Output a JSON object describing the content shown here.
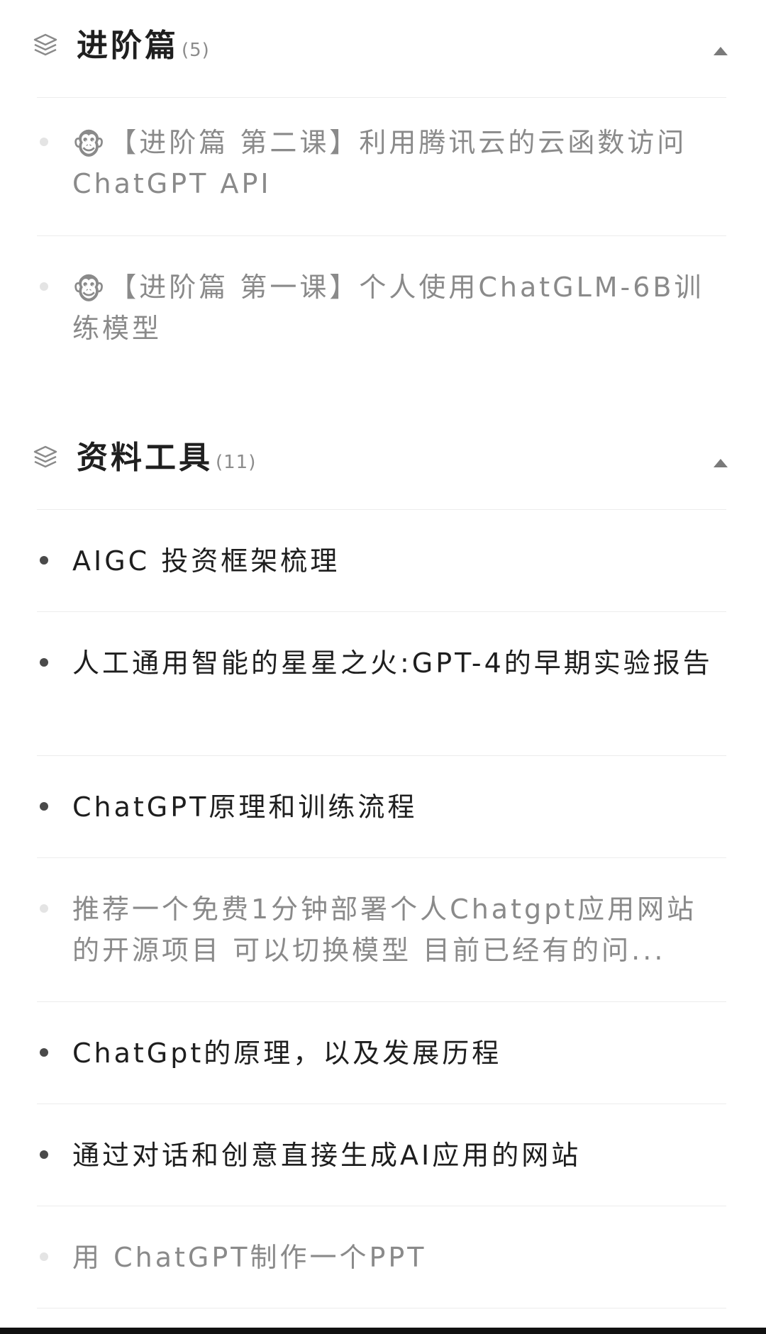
{
  "sections": [
    {
      "title": "进阶篇",
      "count": "(5)",
      "items": [
        {
          "emoji": "🐵",
          "label": "【进阶篇 第二课】利用腾讯云的云函数访问ChatGPT API"
        },
        {
          "emoji": "🐵",
          "label": "【进阶篇 第一课】个人使用ChatGLM-6B训练模型"
        }
      ]
    },
    {
      "title": "资料工具",
      "count": "(11)",
      "items": [
        {
          "label": "AIGC 投资框架梳理"
        },
        {
          "label": "人工通用智能的星星之火:GPT-4的早期实验报告"
        },
        {
          "label": "ChatGPT原理和训练流程"
        },
        {
          "label": "推荐一个免费1分钟部署个人Chatgpt应用网站的开源项目 可以切换模型 目前已经有的问..."
        },
        {
          "label": "ChatGpt的原理，以及发展历程"
        },
        {
          "label": "通过对话和创意直接生成AI应用的网站"
        },
        {
          "label": "用 ChatGPT制作一个PPT"
        }
      ]
    }
  ],
  "icons": {
    "section": "layers-icon",
    "collapse": "caret-up-icon"
  },
  "colors": {
    "text_primary": "#1e1e1e",
    "text_dim": "#8a8a8a",
    "divider": "#ececec"
  }
}
